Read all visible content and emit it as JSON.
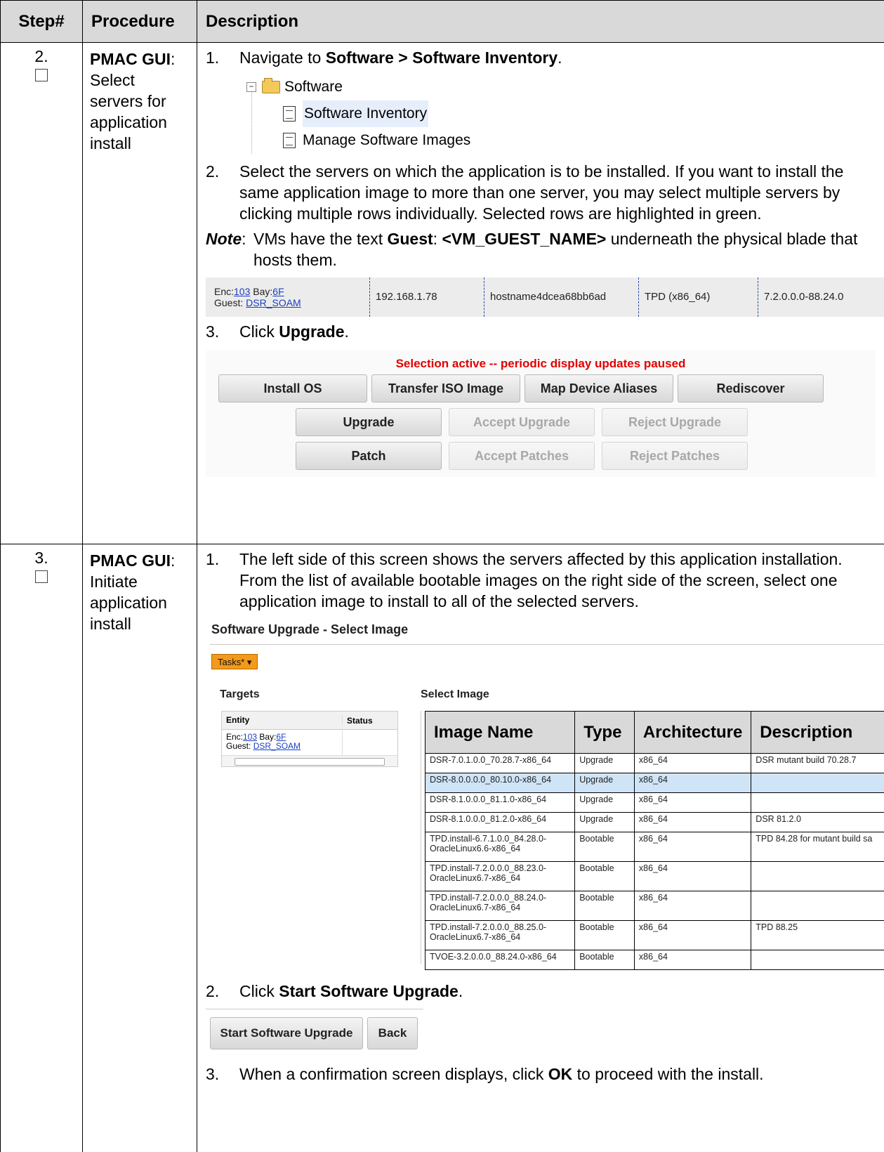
{
  "table_header": {
    "step": "Step#",
    "procedure": "Procedure",
    "description": "Description"
  },
  "step2": {
    "number": "2.",
    "procedure_bold": "PMAC GUI",
    "procedure_rest": ": Select servers for application install",
    "item1_num": "1.",
    "item1_pre": "Navigate to ",
    "item1_bold": "Software > Software Inventory",
    "item1_post": ".",
    "tree": {
      "root": "Software",
      "child1": "Software Inventory",
      "child2": "Manage Software Images"
    },
    "item2_num": "2.",
    "item2_text": "Select the servers on which the application is to be installed.  If you want to install the same application image to more than one server, you may select multiple servers by clicking multiple rows individually.  Selected rows are highlighted in green.",
    "note_label": "Note",
    "note_colon": ":",
    "note_pre": "VMs have the text ",
    "note_bold1": "Guest",
    "note_mid": ":  ",
    "note_bold2": "<VM_GUEST_NAME>",
    "note_post": " underneath the physical blade that hosts them.",
    "server_row": {
      "enc_label": "Enc:",
      "enc_value": "103",
      "bay_label": " Bay:",
      "bay_value": "6F",
      "guest_label": "Guest: ",
      "guest_value": "DSR_SOAM",
      "ip": "192.168.1.78",
      "hostname": "hostname4dcea68bb6ad",
      "os": "TPD (x86_64)",
      "version": "7.2.0.0.0-88.24.0"
    },
    "item3_num": "3.",
    "item3_pre": "Click ",
    "item3_bold": "Upgrade",
    "item3_post": ".",
    "panel": {
      "message": "Selection active -- periodic display updates paused",
      "install_os": "Install OS",
      "transfer_iso": "Transfer ISO Image",
      "map_aliases": "Map Device Aliases",
      "rediscover": "Rediscover",
      "upgrade": "Upgrade",
      "accept_upgrade": "Accept Upgrade",
      "reject_upgrade": "Reject Upgrade",
      "patch": "Patch",
      "accept_patches": "Accept Patches",
      "reject_patches": "Reject Patches"
    }
  },
  "step3": {
    "number": "3.",
    "procedure_bold": "PMAC GUI",
    "procedure_rest": ": Initiate application install",
    "item1_num": "1.",
    "item1_text": "The left side of this screen shows the servers affected by this application installation.  From the list of available bootable images on the right side of the screen, select one application image to install to all of the selected servers.",
    "window_title": "Software Upgrade - Select Image",
    "tasks_label": "Tasks*",
    "targets_header": "Targets",
    "select_image_header": "Select Image",
    "targets_columns": [
      "Entity",
      "Status"
    ],
    "target": {
      "enc_label": "Enc:",
      "enc_value": "103",
      "bay_label": " Bay:",
      "bay_value": "6F",
      "guest_label": "Guest: ",
      "guest_value": "DSR_SOAM"
    },
    "image_columns": [
      "Image Name",
      "Type",
      "Architecture",
      "Description"
    ],
    "images": [
      [
        "DSR-7.0.1.0.0_70.28.7-x86_64",
        "Upgrade",
        "x86_64",
        "DSR mutant build 70.28.7"
      ],
      [
        "DSR-8.0.0.0.0_80.10.0-x86_64",
        "Upgrade",
        "x86_64",
        ""
      ],
      [
        "DSR-8.1.0.0.0_81.1.0-x86_64",
        "Upgrade",
        "x86_64",
        ""
      ],
      [
        "DSR-8.1.0.0.0_81.2.0-x86_64",
        "Upgrade",
        "x86_64",
        "DSR 81.2.0"
      ],
      [
        "TPD.install-6.7.1.0.0_84.28.0-OracleLinux6.6-x86_64",
        "Bootable",
        "x86_64",
        "TPD 84.28 for mutant build sa"
      ],
      [
        "TPD.install-7.2.0.0.0_88.23.0-OracleLinux6.7-x86_64",
        "Bootable",
        "x86_64",
        ""
      ],
      [
        "TPD.install-7.2.0.0.0_88.24.0-OracleLinux6.7-x86_64",
        "Bootable",
        "x86_64",
        ""
      ],
      [
        "TPD.install-7.2.0.0.0_88.25.0-OracleLinux6.7-x86_64",
        "Bootable",
        "x86_64",
        "TPD 88.25"
      ],
      [
        "TVOE-3.2.0.0.0_88.24.0-x86_64",
        "Bootable",
        "x86_64",
        ""
      ]
    ],
    "item2_num": "2.",
    "item2_pre": "Click ",
    "item2_bold": "Start Software Upgrade",
    "item2_post": ".",
    "start_button": "Start Software Upgrade",
    "back_button": "Back",
    "item3_num": "3.",
    "item3_pre": "When a confirmation screen displays, click ",
    "item3_bold": "OK",
    "item3_post": " to proceed with the install."
  }
}
